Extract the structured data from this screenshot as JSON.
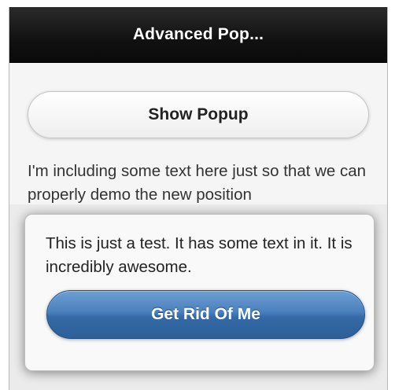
{
  "header": {
    "title": "Advanced Pop..."
  },
  "main": {
    "show_popup_label": "Show Popup",
    "body_text": "I'm including some text here just so that we can properly demo the new position"
  },
  "popup": {
    "message": "This is just a test. It has some text in it. It is incredibly awesome.",
    "dismiss_label": "Get Rid Of Me"
  },
  "colors": {
    "header_bg": "#111111",
    "button_accent": "#3a6fab"
  }
}
